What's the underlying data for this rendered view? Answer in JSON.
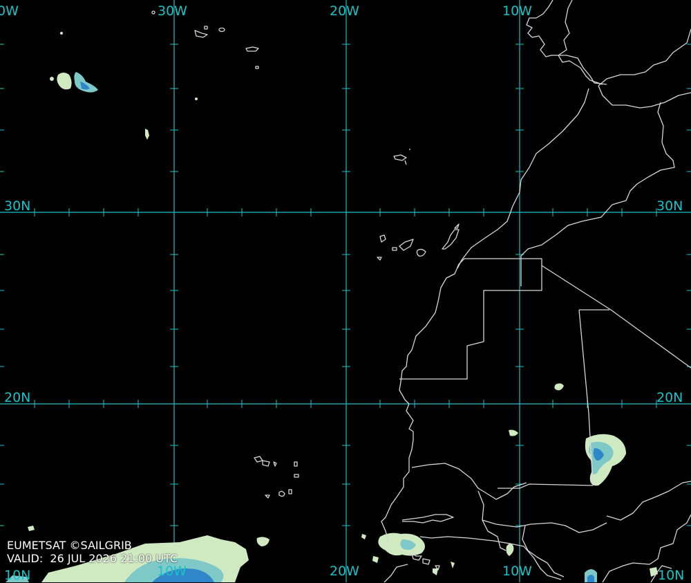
{
  "map": {
    "grid_color": "#19c3c8",
    "coast_color": "#d8d8d8",
    "cloud_colors": [
      "#cfeac0",
      "#7ec8c8",
      "#2f86c8"
    ],
    "longitude_labels_top": [
      "0W",
      "30W",
      "20W",
      "10W"
    ],
    "longitude_labels_bottom": [
      "10W",
      "20W",
      "10W"
    ],
    "latitude_labels_left": [
      "30N",
      "20N"
    ],
    "latitude_labels_right": [
      "30N",
      "20N",
      "10N"
    ],
    "corner_bottom_left": "10N"
  },
  "credit": {
    "source": "EUMETSAT ©SAILGRIB",
    "valid": "VALID:  26 JUL 2026 21:00 UTC"
  }
}
